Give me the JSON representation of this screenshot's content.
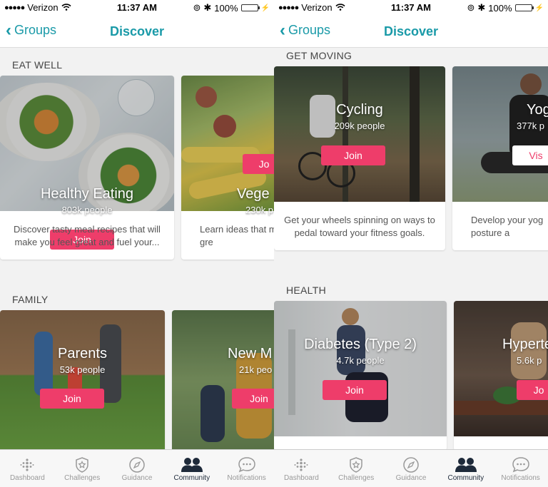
{
  "colors": {
    "accent": "#1a9aa8",
    "join": "#ee3d6a"
  },
  "status": {
    "carrier": "Verizon",
    "time": "11:37 AM",
    "battery": "100%"
  },
  "nav": {
    "back_label": "Groups",
    "title": "Discover"
  },
  "tabs": [
    {
      "label": "Dashboard",
      "icon": "dashboard-dots-icon"
    },
    {
      "label": "Challenges",
      "icon": "star-shield-icon"
    },
    {
      "label": "Guidance",
      "icon": "compass-icon"
    },
    {
      "label": "Community",
      "icon": "people-icon",
      "active": true
    },
    {
      "label": "Notifications",
      "icon": "chat-bubble-icon"
    }
  ],
  "left": {
    "sections": [
      {
        "title": "EAT WELL",
        "cards": [
          {
            "name": "Healthy Eating",
            "count": "803k people",
            "button": "Join",
            "description": "Discover tasty meal recipes that will make you feel great and fuel your..."
          },
          {
            "name": "Vege",
            "count": "230k p",
            "button": "Jo",
            "description": "Learn ideas that m gre"
          }
        ]
      },
      {
        "title": "FAMILY",
        "cards": [
          {
            "name": "Parents",
            "count": "53k people",
            "button": "Join"
          },
          {
            "name": "New M",
            "count": "21k peo",
            "button": "Join"
          }
        ]
      }
    ]
  },
  "right": {
    "sections": [
      {
        "title": "GET MOVING",
        "cards": [
          {
            "name": "Cycling",
            "count": "209k people",
            "button": "Join",
            "description": "Get your wheels spinning on ways to pedal toward your fitness goals."
          },
          {
            "name": "Yog",
            "count": "377k p",
            "button": "Vis",
            "description": "Develop your yog posture a"
          }
        ]
      },
      {
        "title": "HEALTH",
        "cards": [
          {
            "name": "Diabetes (Type 2)",
            "count": "4.7k people",
            "button": "Join"
          },
          {
            "name": "Hyperte",
            "count": "5.6k p",
            "button": "Jo"
          }
        ]
      }
    ]
  }
}
